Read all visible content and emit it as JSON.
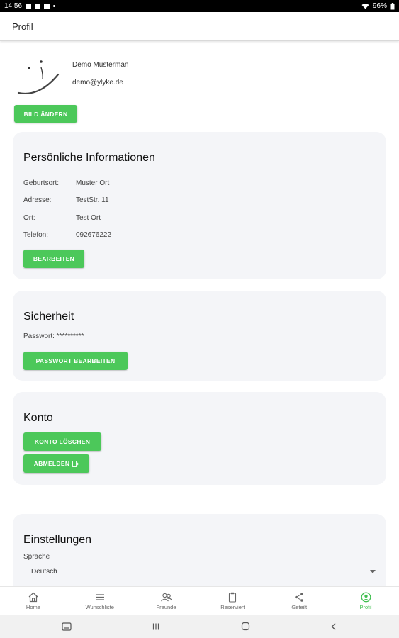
{
  "status_bar": {
    "time": "14:56",
    "battery": "96%"
  },
  "app_bar": {
    "title": "Profil"
  },
  "profile": {
    "name": "Demo Musterman",
    "email": "demo@ylyke.de",
    "change_picture_label": "BILD ÄNDERN"
  },
  "personal_info": {
    "title": "Persönliche Informationen",
    "rows": [
      {
        "label": "Geburtsort:",
        "value": "Muster Ort"
      },
      {
        "label": "Adresse:",
        "value": "TestStr. 11"
      },
      {
        "label": "Ort:",
        "value": "Test Ort"
      },
      {
        "label": "Telefon:",
        "value": "092676222"
      }
    ],
    "edit_label": "BEARBEITEN"
  },
  "security": {
    "title": "Sicherheit",
    "password_text": "Passwort: **********",
    "edit_password_label": "PASSWORT BEARBEITEN"
  },
  "account": {
    "title": "Konto",
    "delete_label": "KONTO LÖSCHEN",
    "logout_label": "ABMELDEN"
  },
  "settings": {
    "title": "Einstellungen",
    "language_label": "Sprache",
    "language_value": "Deutsch"
  },
  "bottom_nav": [
    {
      "label": "Home",
      "icon": "home-icon",
      "active": false
    },
    {
      "label": "Wunschliste",
      "icon": "list-icon",
      "active": false
    },
    {
      "label": "Freunde",
      "icon": "friends-icon",
      "active": false
    },
    {
      "label": "Reserviert",
      "icon": "clipboard-icon",
      "active": false
    },
    {
      "label": "Geteilt",
      "icon": "share-icon",
      "active": false
    },
    {
      "label": "Profil",
      "icon": "profile-icon",
      "active": true
    }
  ],
  "colors": {
    "accent": "#4cc85a",
    "active_nav": "#3fbe4f",
    "card_bg": "#f4f5f8"
  }
}
